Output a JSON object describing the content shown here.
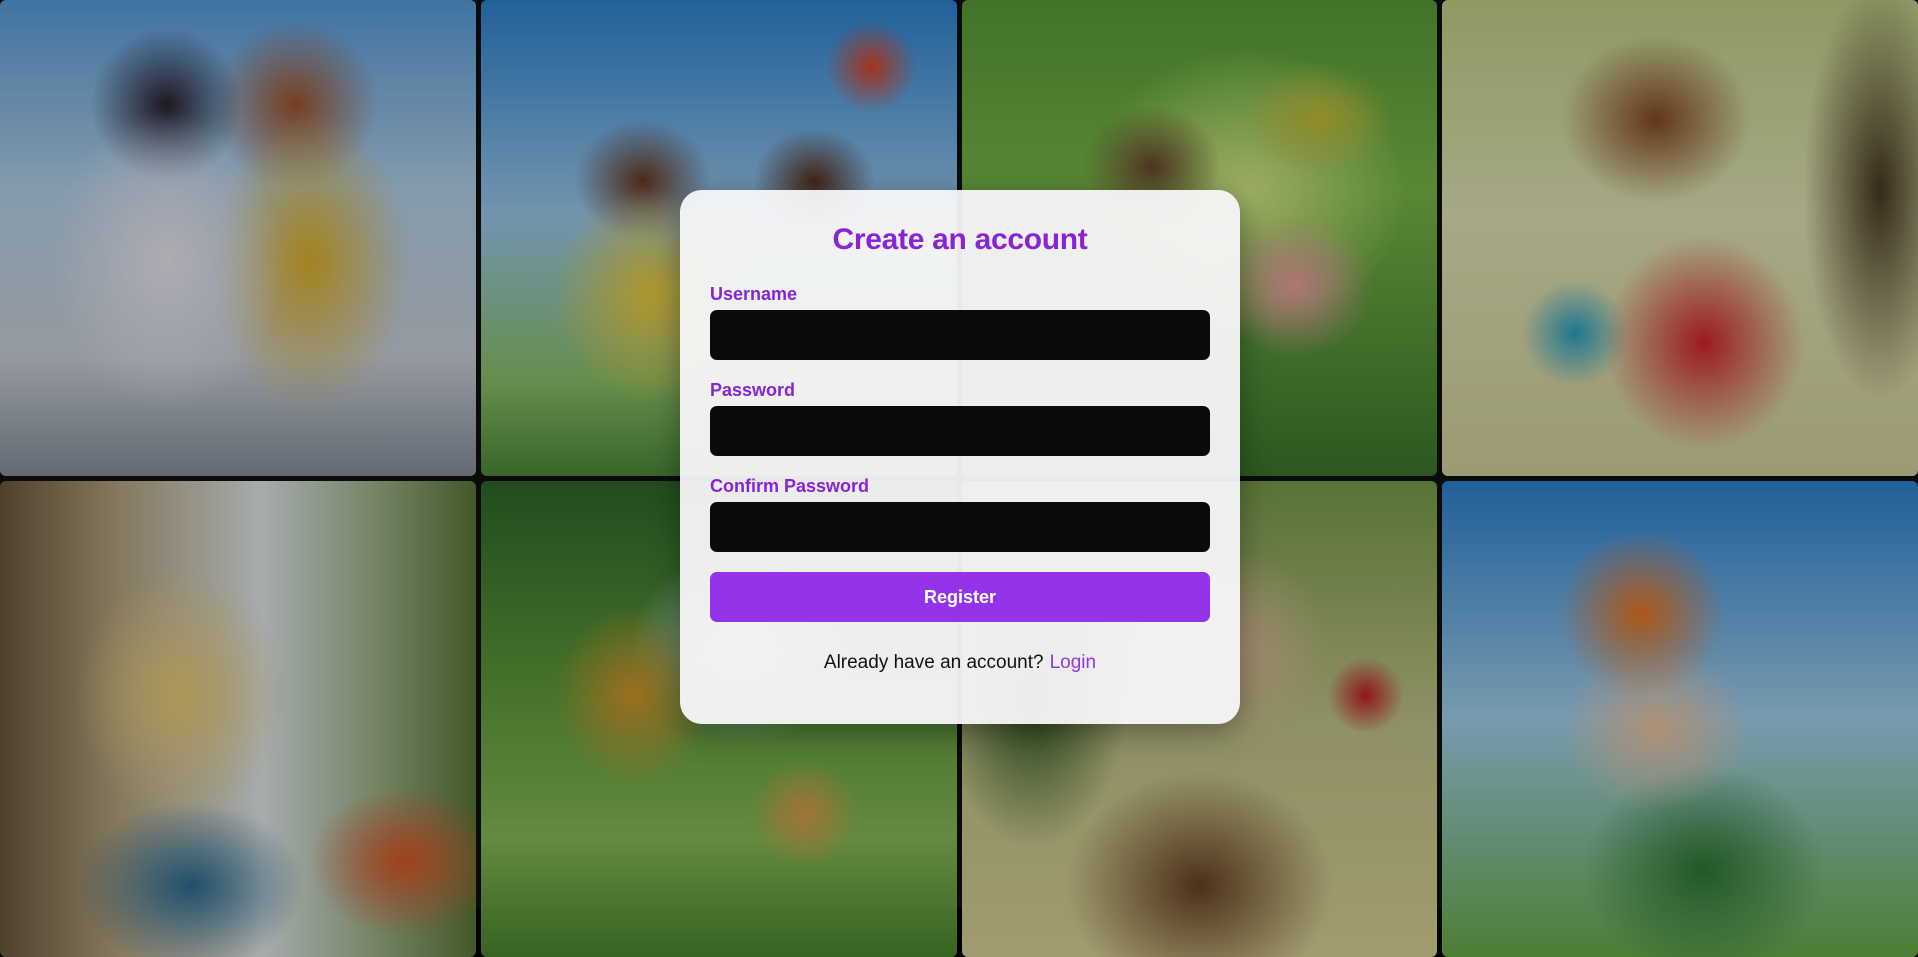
{
  "gallery": {
    "images": [
      {
        "name": "two-girls-city-street"
      },
      {
        "name": "children-with-kite"
      },
      {
        "name": "fairy-and-bee-rose"
      },
      {
        "name": "girl-with-blue-bunny"
      },
      {
        "name": "blonde-girl-window"
      },
      {
        "name": "lion-and-cub"
      },
      {
        "name": "boy-with-roses"
      },
      {
        "name": "boy-with-bubbles"
      }
    ]
  },
  "form": {
    "title": "Create an account",
    "username_label": "Username",
    "username_value": "",
    "password_label": "Password",
    "password_value": "",
    "confirm_password_label": "Confirm Password",
    "confirm_password_value": "",
    "register_label": "Register",
    "footer_text": "Already have an account?",
    "login_link": "Login"
  },
  "colors": {
    "accent": "#9333ea",
    "title": "#8a22d6",
    "input_bg": "#0b0b0c",
    "card_bg": "#f8f8f9"
  }
}
